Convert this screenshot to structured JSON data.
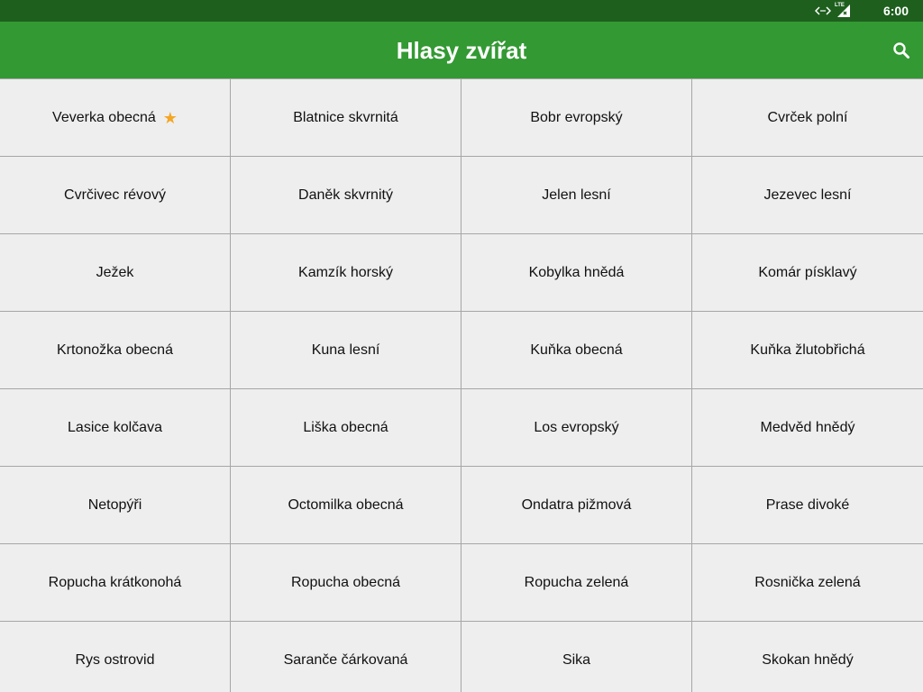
{
  "status_bar": {
    "time": "6:00",
    "network_label": "LTE"
  },
  "app_bar": {
    "title": "Hlasy zvířat",
    "search_icon": "search-icon"
  },
  "colors": {
    "status_bar": "#1e5f1e",
    "app_bar": "#339933",
    "grid_background": "#eeeeee",
    "grid_border": "#a6a6a6",
    "favorite_star": "#f5a623"
  },
  "animals": [
    {
      "label": "Veverka obecná",
      "favorite": true
    },
    {
      "label": "Blatnice skvrnitá",
      "favorite": false
    },
    {
      "label": "Bobr evropský",
      "favorite": false
    },
    {
      "label": "Cvrček polní",
      "favorite": false
    },
    {
      "label": "Cvrčivec révový",
      "favorite": false
    },
    {
      "label": "Daněk skvrnitý",
      "favorite": false
    },
    {
      "label": "Jelen lesní",
      "favorite": false
    },
    {
      "label": "Jezevec lesní",
      "favorite": false
    },
    {
      "label": "Ježek",
      "favorite": false
    },
    {
      "label": "Kamzík horský",
      "favorite": false
    },
    {
      "label": "Kobylka hnědá",
      "favorite": false
    },
    {
      "label": "Komár písklavý",
      "favorite": false
    },
    {
      "label": "Krtonožka obecná",
      "favorite": false
    },
    {
      "label": "Kuna lesní",
      "favorite": false
    },
    {
      "label": "Kuňka obecná",
      "favorite": false
    },
    {
      "label": "Kuňka žlutobřichá",
      "favorite": false
    },
    {
      "label": "Lasice kolčava",
      "favorite": false
    },
    {
      "label": "Liška obecná",
      "favorite": false
    },
    {
      "label": "Los evropský",
      "favorite": false
    },
    {
      "label": "Medvěd hnědý",
      "favorite": false
    },
    {
      "label": "Netopýři",
      "favorite": false
    },
    {
      "label": "Octomilka obecná",
      "favorite": false
    },
    {
      "label": "Ondatra pižmová",
      "favorite": false
    },
    {
      "label": "Prase divoké",
      "favorite": false
    },
    {
      "label": "Ropucha krátkonohá",
      "favorite": false
    },
    {
      "label": "Ropucha obecná",
      "favorite": false
    },
    {
      "label": "Ropucha zelená",
      "favorite": false
    },
    {
      "label": "Rosnička zelená",
      "favorite": false
    },
    {
      "label": "Rys ostrovid",
      "favorite": false
    },
    {
      "label": "Saranče čárkovaná",
      "favorite": false
    },
    {
      "label": "Sika",
      "favorite": false
    },
    {
      "label": "Skokan hnědý",
      "favorite": false
    }
  ]
}
